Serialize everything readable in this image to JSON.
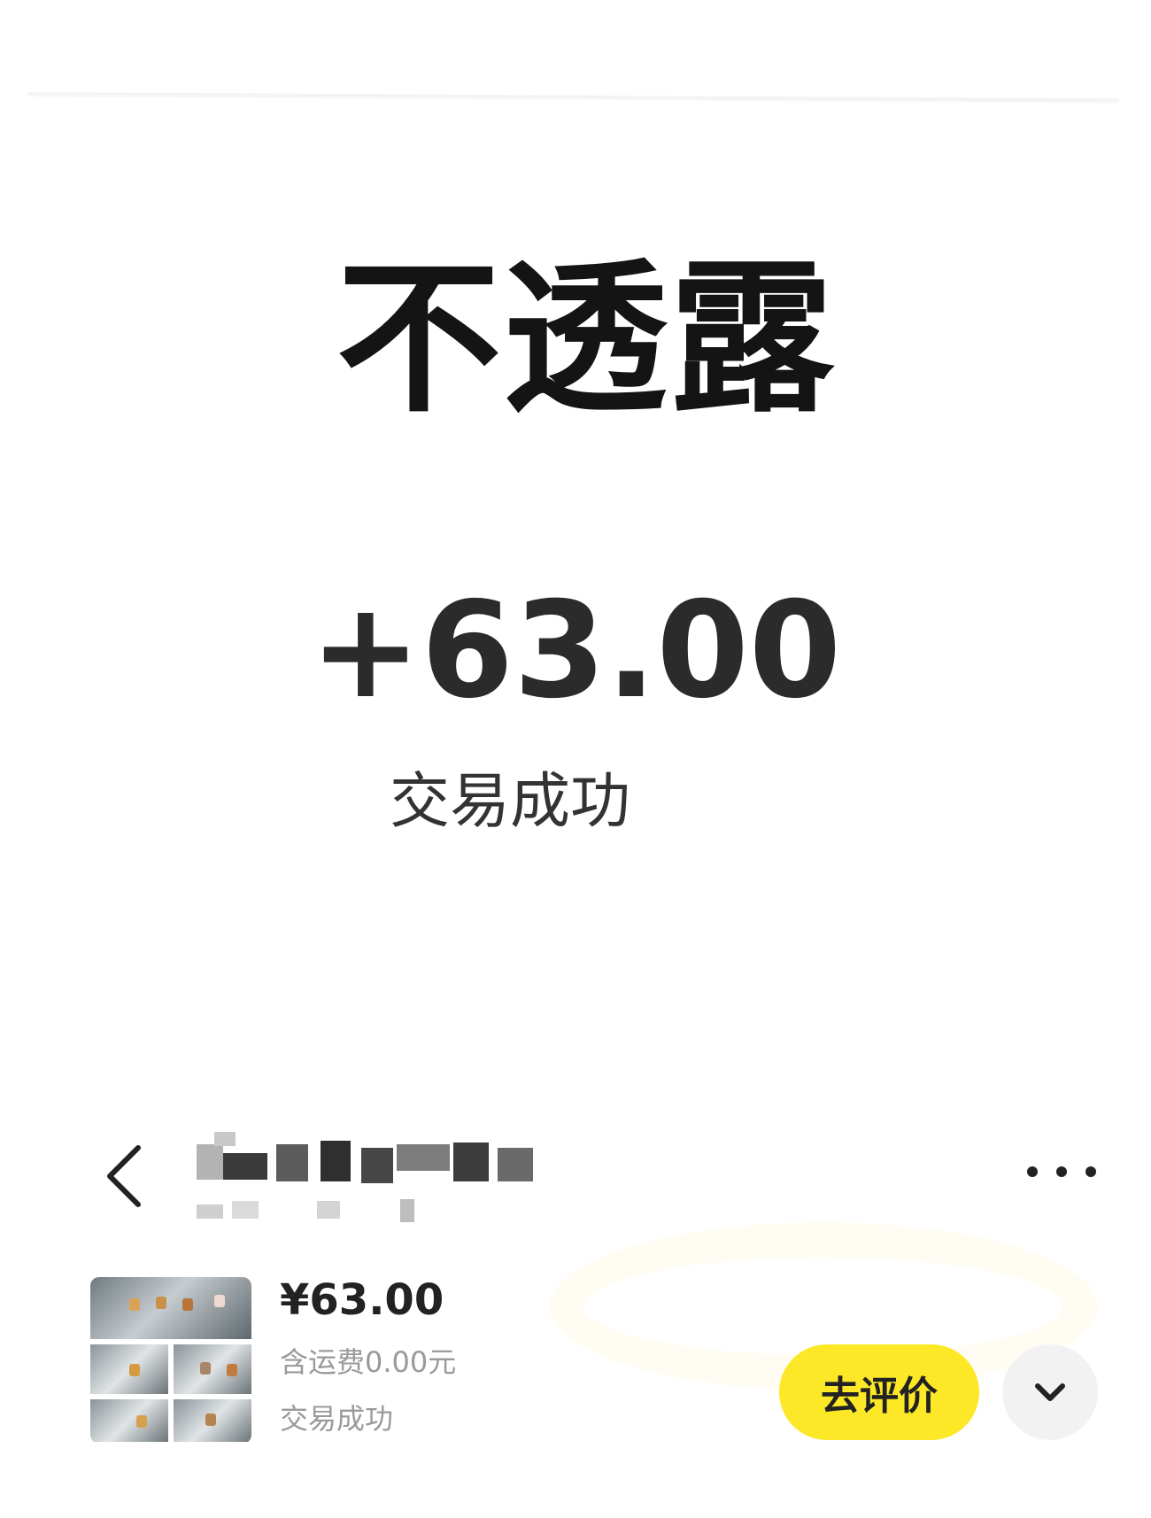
{
  "headline": "不透露",
  "transaction": {
    "amount": "+63.00",
    "status": "交易成功"
  },
  "order_card": {
    "price": "¥63.00",
    "shipping_note": "含运费0.00元",
    "status": "交易成功",
    "review_label": "去评价"
  },
  "icons": {
    "back": "chevron-left-icon",
    "more": "more-dots-icon",
    "expand": "chevron-down-icon"
  },
  "colors": {
    "accent_yellow": "#fde827",
    "muted_text": "#9a9a9a"
  }
}
